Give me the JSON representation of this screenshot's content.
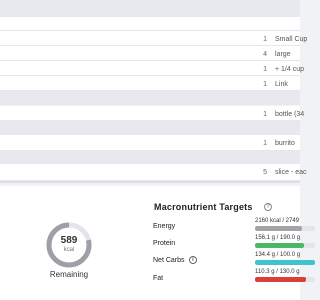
{
  "food_list": {
    "rows": [
      {
        "type": "header"
      },
      {
        "type": "item",
        "qty": "",
        "unit": ""
      },
      {
        "type": "item",
        "qty": "1",
        "unit": "Small Cup"
      },
      {
        "type": "item",
        "qty": "4",
        "unit": "large"
      },
      {
        "type": "item",
        "qty": "1",
        "unit": "+ 1/4 cup"
      },
      {
        "type": "item",
        "qty": "1",
        "unit": "Link"
      },
      {
        "type": "header"
      },
      {
        "type": "item",
        "qty": "1",
        "unit": "bottle (34"
      },
      {
        "type": "header"
      },
      {
        "type": "item",
        "qty": "1",
        "unit": "burrito"
      },
      {
        "type": "header"
      },
      {
        "type": "item",
        "qty": "5",
        "unit": "slice - eac"
      }
    ]
  },
  "summary": {
    "kcal_value": "589",
    "kcal_unit": "kcal",
    "remaining_fraction": 0.21,
    "remaining_label": "Remaining"
  },
  "macros": {
    "title": "Macronutrient Targets",
    "help_icon": "help-circle-icon",
    "info_icon": "info-icon",
    "items": [
      {
        "label": "Energy",
        "value": "2160 kcal / 2749",
        "fraction": 0.79,
        "color": "#a3a3a8"
      },
      {
        "label": "Protein",
        "value": "156.1 g / 190.0 g",
        "fraction": 0.82,
        "color": "#4ab867"
      },
      {
        "label": "Net Carbs",
        "value": "134.4 g / 100.0 g",
        "fraction": 1.0,
        "color": "#3ec3cf"
      },
      {
        "label": "Fat",
        "value": "110.3 g / 130.0 g",
        "fraction": 0.85,
        "color": "#d94038"
      }
    ]
  },
  "colors": {
    "ring_track": "#e4e5ea",
    "ring_fill": "#9ea0a6"
  }
}
